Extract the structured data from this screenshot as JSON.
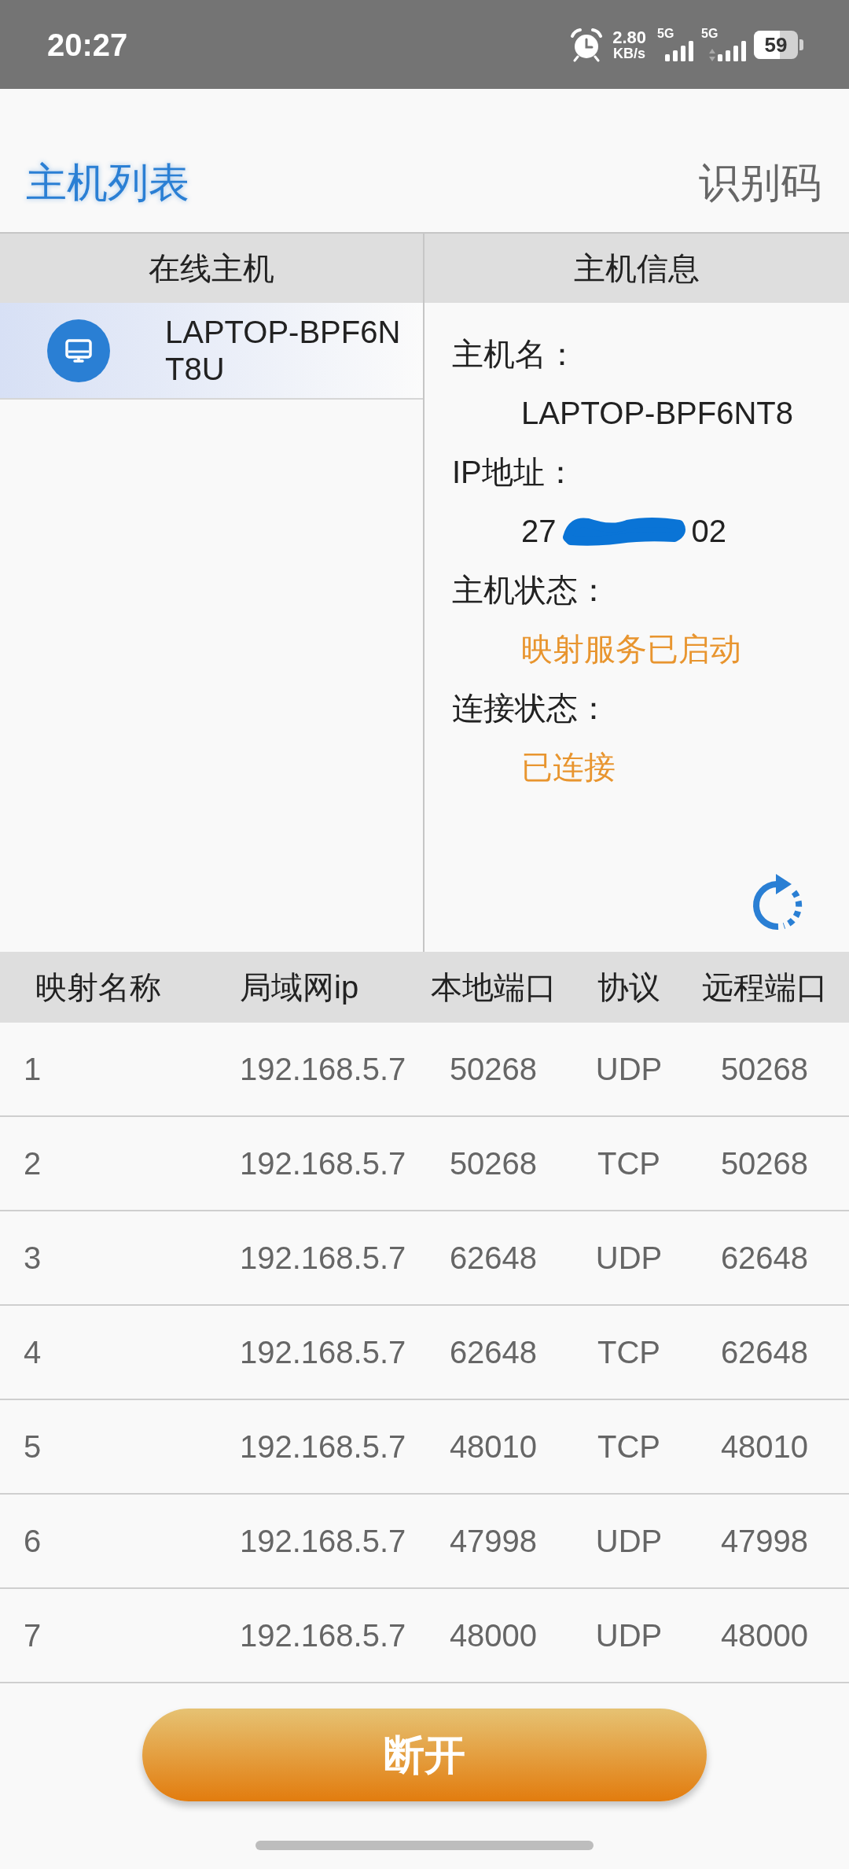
{
  "status_bar": {
    "time": "20:27",
    "net_speed": "2.80",
    "net_speed_unit": "KB/s",
    "sims": [
      {
        "label": "5G",
        "data_arrows": false
      },
      {
        "label": "5G",
        "data_arrows": true
      }
    ],
    "battery": {
      "text": "59",
      "level": 0.59
    }
  },
  "header": {
    "title": "主机列表",
    "action": "识别码"
  },
  "online_hosts": {
    "heading": "在线主机",
    "items": [
      {
        "name": "LAPTOP-BPF6NT8U",
        "selected": true
      }
    ]
  },
  "host_info": {
    "heading": "主机信息",
    "fields": [
      {
        "label": "主机名：",
        "kind": "plain",
        "value": "LAPTOP-BPF6NT8"
      },
      {
        "label": "IP地址：",
        "kind": "redacted",
        "value_start": "27",
        "value_end": "02"
      },
      {
        "label": "主机状态：",
        "kind": "status",
        "value": "映射服务已启动"
      },
      {
        "label": "连接状态：",
        "kind": "status",
        "value": "已连接"
      }
    ]
  },
  "mappings": {
    "columns": [
      "映射名称",
      "局域网ip",
      "本地端口",
      "协议",
      "远程端口"
    ],
    "rows": [
      [
        "1",
        "192.168.5.7",
        "50268",
        "UDP",
        "50268"
      ],
      [
        "2",
        "192.168.5.7",
        "50268",
        "TCP",
        "50268"
      ],
      [
        "3",
        "192.168.5.7",
        "62648",
        "UDP",
        "62648"
      ],
      [
        "4",
        "192.168.5.7",
        "62648",
        "TCP",
        "62648"
      ],
      [
        "5",
        "192.168.5.7",
        "48010",
        "TCP",
        "48010"
      ],
      [
        "6",
        "192.168.5.7",
        "47998",
        "UDP",
        "47998"
      ],
      [
        "7",
        "192.168.5.7",
        "48000",
        "UDP",
        "48000"
      ]
    ]
  },
  "disconnect_button": "断开"
}
